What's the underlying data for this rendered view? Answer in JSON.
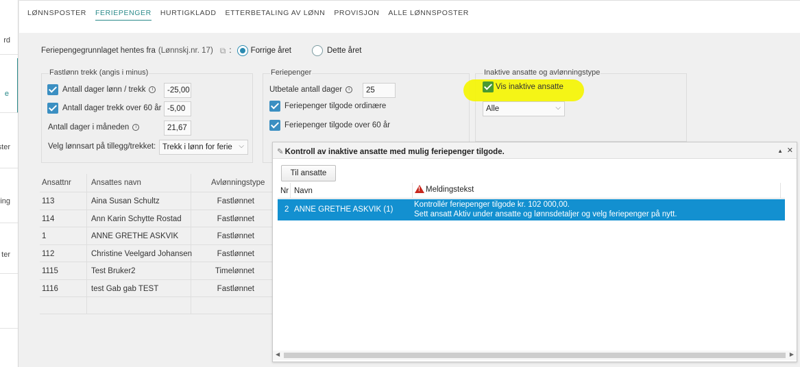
{
  "sidebar": {
    "items": [
      {
        "label": "rd",
        "active": false
      },
      {
        "label": "e",
        "active": true
      },
      {
        "label": "ster",
        "active": false
      },
      {
        "label": "ring",
        "active": false
      },
      {
        "label": "ter",
        "active": false
      }
    ]
  },
  "tabs": [
    {
      "label": "LØNNSPOSTER",
      "active": false
    },
    {
      "label": "FERIEPENGER",
      "active": true
    },
    {
      "label": "HURTIGKLADD",
      "active": false
    },
    {
      "label": "ETTERBETALING AV LØNN",
      "active": false
    },
    {
      "label": "PROVISJON",
      "active": false
    },
    {
      "label": "ALLE LØNNSPOSTER",
      "active": false
    }
  ],
  "source": {
    "label": "Feriepengegrunnlaget hentes fra",
    "ref": "(Lønnskj.nr. 17)",
    "colon": ":",
    "option_prev": "Forrige året",
    "option_this": "Dette året"
  },
  "fastlonn": {
    "title": "Fastlønn trekk (angis i minus)",
    "days_label": "Antall dager lønn / trekk",
    "days_value": "-25,00",
    "days60_label": "Antall dager trekk over 60 år",
    "days60_value": "-5,00",
    "month_label": "Antall dager i måneden",
    "month_value": "21,67",
    "type_label": "Velg lønnsart på tillegg/trekket:",
    "type_value": "Trekk i lønn for ferie"
  },
  "feriepenger": {
    "title": "Feriepenger",
    "pay_days_label": "Utbetale antall dager",
    "pay_days_value": "25",
    "ordinary_label": "Feriepenger tilgode ordinære",
    "over60_label": "Feriepenger tilgode over 60 år"
  },
  "inactive": {
    "title": "Inaktive ansatte og avlønningstype",
    "show_label": "Vis inaktive ansatte",
    "filter_value": "Alle"
  },
  "employees": {
    "headers": [
      "Ansattnr",
      "Ansattes navn",
      "Avlønningstype"
    ],
    "rows": [
      {
        "nr": "113",
        "name": "Aina Susan Schultz",
        "type": "Fastlønnet"
      },
      {
        "nr": "114",
        "name": "Ann Karin Schytte Rostad",
        "type": "Fastlønnet"
      },
      {
        "nr": "1",
        "name": "ANNE GRETHE ASKVIK",
        "type": "Fastlønnet"
      },
      {
        "nr": "112",
        "name": "Christine Veelgard Johansen",
        "type": "Fastlønnet"
      },
      {
        "nr": "1115",
        "name": "Test Bruker2",
        "type": "Timelønnet"
      },
      {
        "nr": "1116",
        "name": "test Gab gab TEST",
        "type": "Fastlønnet"
      }
    ]
  },
  "dialog": {
    "title": "Kontroll av inaktive ansatte med mulig feriepenger tilgode.",
    "minimize": "▲",
    "close": "✕",
    "button": "Til ansatte",
    "headers": {
      "nr": "Nr",
      "name": "Navn",
      "message": "Meldingstekst"
    },
    "rows": [
      {
        "nr": "2",
        "name": "ANNE GRETHE ASKVIK (1)",
        "line1": "Kontrollér feriepenger tilgode kr. 102 000,00.",
        "line2": "Sett ansatt Aktiv under ansatte og lønnsdetaljer og velg feriepenger på nytt."
      }
    ]
  },
  "colors": {
    "accent": "#2a8a8a",
    "selection": "#1390d0",
    "checkbox": "#3b8fc2",
    "highlight": "#f4f40a"
  }
}
